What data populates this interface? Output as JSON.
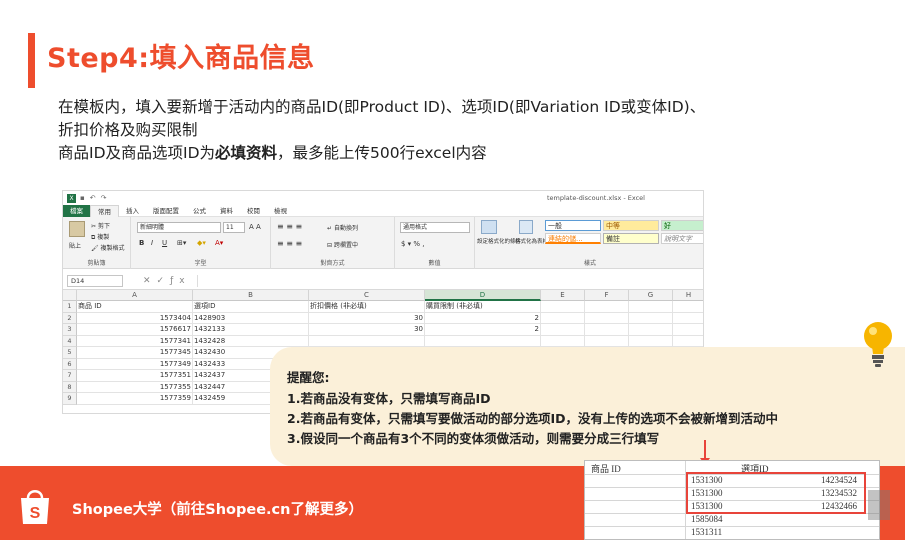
{
  "header": {
    "title": "Step4:填入商品信息"
  },
  "description": {
    "line1": "在模板内，填入要新增于活动内的商品ID(即Product ID)、选项ID(即Variation ID或变体ID)、",
    "line2": "折扣价格及购买限制",
    "line3_prefix": "商品ID及商品选项ID为",
    "line3_bold": "必填资料",
    "line3_suffix": "，最多能上传500行excel内容"
  },
  "excel": {
    "filename": "template-discount.xlsx - Excel",
    "tabs": [
      "檔案",
      "常用",
      "插入",
      "版面配置",
      "公式",
      "資料",
      "校閱",
      "檢視"
    ],
    "ribbon": {
      "clipboard_label": "剪貼簿",
      "paste": "貼上",
      "cut": "剪下",
      "copy": "複製",
      "format_painter": "複製格式",
      "font_label": "字型",
      "font_name": "新細明體",
      "font_size": "11",
      "bold": "B",
      "italic": "I",
      "underline": "U",
      "alignment_label": "對齊方式",
      "wrap": "自動換列",
      "merge": "跨欄置中",
      "number_label": "數值",
      "number_format": "通用格式",
      "cond_format": "設定格式化的條件",
      "table_format": "格式化為表格",
      "styles_label": "樣式",
      "style_normal": "一般",
      "style_medium": "中等",
      "style_good": "好",
      "style_link": "連結的儲...",
      "style_note": "備註",
      "style_explain": "說明文字"
    },
    "name_box": "D14",
    "columns": [
      "A",
      "B",
      "C",
      "D",
      "E",
      "F",
      "G",
      "H"
    ],
    "rows": [
      {
        "n": "1",
        "a": "商品 ID",
        "b": "選項ID",
        "c": "折扣價格 (非必填)",
        "d": "購買限制 (非必填)"
      },
      {
        "n": "2",
        "a": "1573404",
        "b": "1428903",
        "c": "30",
        "d": "2"
      },
      {
        "n": "3",
        "a": "1576617",
        "b": "1432133",
        "c": "30",
        "d": "2"
      },
      {
        "n": "4",
        "a": "1577341",
        "b": "1432428",
        "c": "",
        "d": ""
      },
      {
        "n": "5",
        "a": "1577345",
        "b": "1432430",
        "c": "",
        "d": ""
      },
      {
        "n": "6",
        "a": "1577349",
        "b": "1432433",
        "c": "",
        "d": ""
      },
      {
        "n": "7",
        "a": "1577351",
        "b": "1432437",
        "c": "",
        "d": ""
      },
      {
        "n": "8",
        "a": "1577355",
        "b": "1432447",
        "c": "",
        "d": ""
      },
      {
        "n": "9",
        "a": "1577359",
        "b": "1432459",
        "c": "",
        "d": ""
      }
    ]
  },
  "reminder": {
    "title": "提醒您:",
    "items": [
      "1.若商品没有变体，只需填写商品ID",
      "2.若商品有变体，只需填写要做活动的部分选项ID，没有上传的选项不会被新增到活动中",
      "3.假设同一个商品有3个不同的变体须做活动，则需要分成三行填写"
    ]
  },
  "inset": {
    "header_a": "商品 ID",
    "header_b": "選項ID",
    "rows": [
      {
        "a": "1531300",
        "b": "14234524"
      },
      {
        "a": "1531300",
        "b": "13234532"
      },
      {
        "a": "1531300",
        "b": "12432466"
      },
      {
        "a": "1585084",
        "b": ""
      },
      {
        "a": "1531311",
        "b": ""
      }
    ]
  },
  "footer": {
    "text": "Shopee大学（前往Shopee.cn了解更多）"
  },
  "colors": {
    "brand": "#ee4d2d",
    "excel_green": "#217346",
    "reminder_bg": "#fbf0d9",
    "highlight_red": "#e8443a"
  },
  "icons": [
    "lightbulb-icon",
    "shopee-bag-icon",
    "excel-logo-icon"
  ]
}
